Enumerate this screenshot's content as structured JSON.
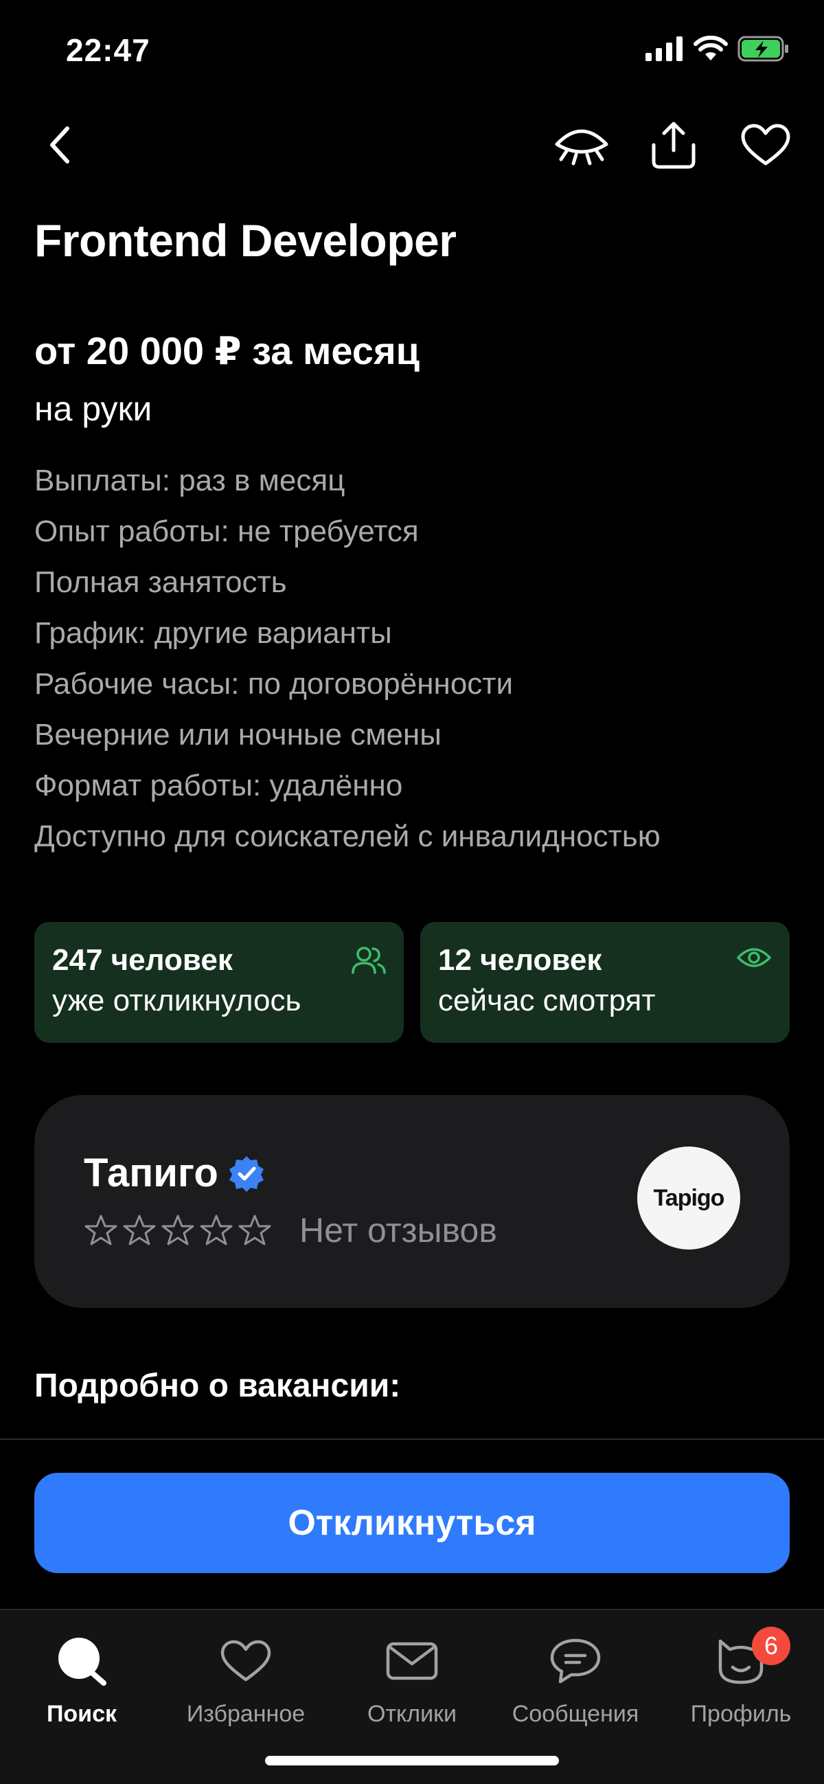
{
  "status_bar": {
    "time": "22:47"
  },
  "vacancy": {
    "title": "Frontend Developer",
    "salary": "от 20 000 ₽ за месяц",
    "salary_note": "на руки",
    "details": [
      "Выплаты: раз в месяц",
      "Опыт работы: не требуется",
      "Полная занятость",
      "График: другие варианты",
      "Рабочие часы: по договорённости",
      "Вечерние или ночные смены",
      "Формат работы: удалённо",
      "Доступно для соискателей с инвалидностью"
    ]
  },
  "stats": {
    "responded": {
      "title": "247 человек",
      "subtitle": "уже откликнулось",
      "icon": "people-icon"
    },
    "viewing": {
      "title": "12 человек",
      "subtitle": "сейчас смотрят",
      "icon": "eye-icon"
    }
  },
  "company": {
    "name": "Тапиго",
    "verified_icon": "verified-badge-icon",
    "rating_stars": 0,
    "rating_max": 5,
    "reviews_text": "Нет отзывов",
    "logo_text": "Tapigo"
  },
  "section_heading": "Подробно о вакансии:",
  "apply_button": "Откликнуться",
  "tabbar": {
    "tabs": [
      {
        "label": "Поиск",
        "icon": "search-icon",
        "active": true
      },
      {
        "label": "Избранное",
        "icon": "heart-icon",
        "active": false
      },
      {
        "label": "Отклики",
        "icon": "mail-icon",
        "active": false
      },
      {
        "label": "Сообщения",
        "icon": "chat-icon",
        "active": false
      },
      {
        "label": "Профиль",
        "icon": "profile-icon",
        "active": false,
        "badge": "6"
      }
    ]
  },
  "colors": {
    "accent": "#2f7bfb",
    "stat_card_bg": "#16301f",
    "stat_icon": "#3dbd6b",
    "verified": "#3b82f6",
    "badge": "#f34a3d"
  }
}
